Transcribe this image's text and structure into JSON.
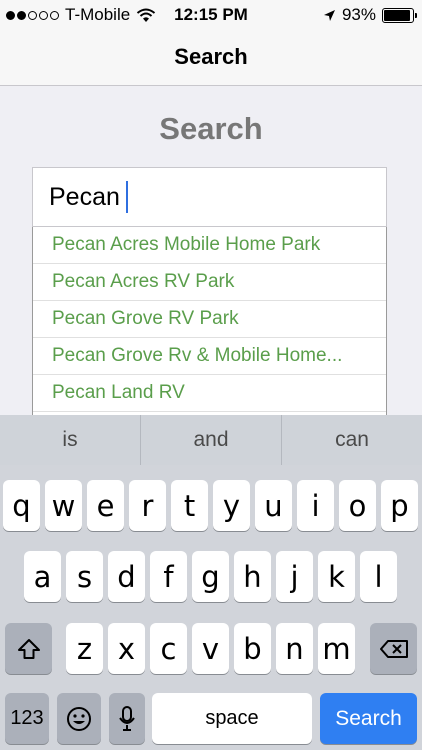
{
  "status_bar": {
    "carrier": "T-Mobile",
    "time": "12:15 PM",
    "battery": "93%",
    "battery_level": 0.93,
    "signal_bars_filled": 2,
    "signal_bars_total": 5
  },
  "nav": {
    "title": "Search"
  },
  "main": {
    "heading": "Search",
    "search_value": "Pecan",
    "suggestions": [
      "Pecan Acres Mobile Home Park",
      "Pecan Acres RV Park",
      "Pecan Grove RV Park",
      "Pecan Grove Rv & Mobile Home...",
      "Pecan Land RV"
    ],
    "suggestion_color": "#5a9e4b"
  },
  "keyboard": {
    "predictions": [
      "is",
      "and",
      "can"
    ],
    "row1": [
      "q",
      "w",
      "e",
      "r",
      "t",
      "y",
      "u",
      "i",
      "o",
      "p"
    ],
    "row2": [
      "a",
      "s",
      "d",
      "f",
      "g",
      "h",
      "j",
      "k",
      "l"
    ],
    "row3": [
      "z",
      "x",
      "c",
      "v",
      "b",
      "n",
      "m"
    ],
    "numbers_label": "123",
    "space_label": "space",
    "search_label": "Search",
    "accent_color": "#2f7ff2"
  }
}
